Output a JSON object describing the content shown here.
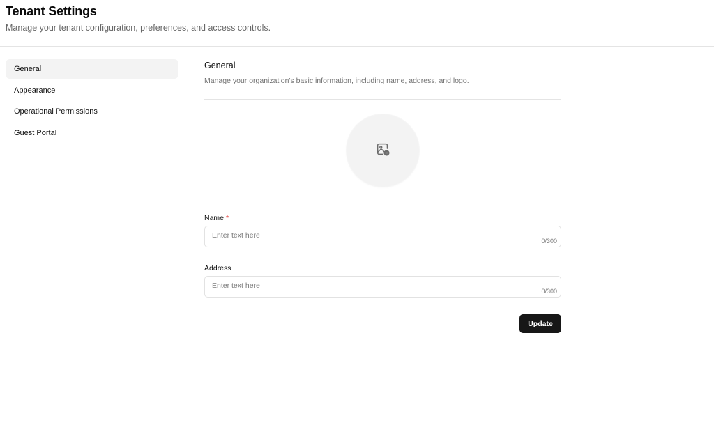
{
  "header": {
    "title": "Tenant Settings",
    "subtitle": "Manage your tenant configuration, preferences, and access controls."
  },
  "sidebar": {
    "active": "General",
    "items": [
      {
        "label": "General"
      },
      {
        "label": "Appearance"
      },
      {
        "label": "Operational Permissions"
      },
      {
        "label": "Guest Portal"
      }
    ]
  },
  "general": {
    "title": "General",
    "description": "Manage your organization's basic information, including name, address, and logo.",
    "logo_icon": "image-upload-icon",
    "fields": {
      "name": {
        "label": "Name",
        "required_marker": "*",
        "value": "",
        "placeholder": "Enter text here",
        "counter": "0/300"
      },
      "address": {
        "label": "Address",
        "value": "",
        "placeholder": "Enter text here",
        "counter": "0/300"
      }
    },
    "update_label": "Update"
  },
  "colors": {
    "primary_button": "#171717",
    "active_nav_bg": "#f3f3f3",
    "required": "#e53935"
  }
}
